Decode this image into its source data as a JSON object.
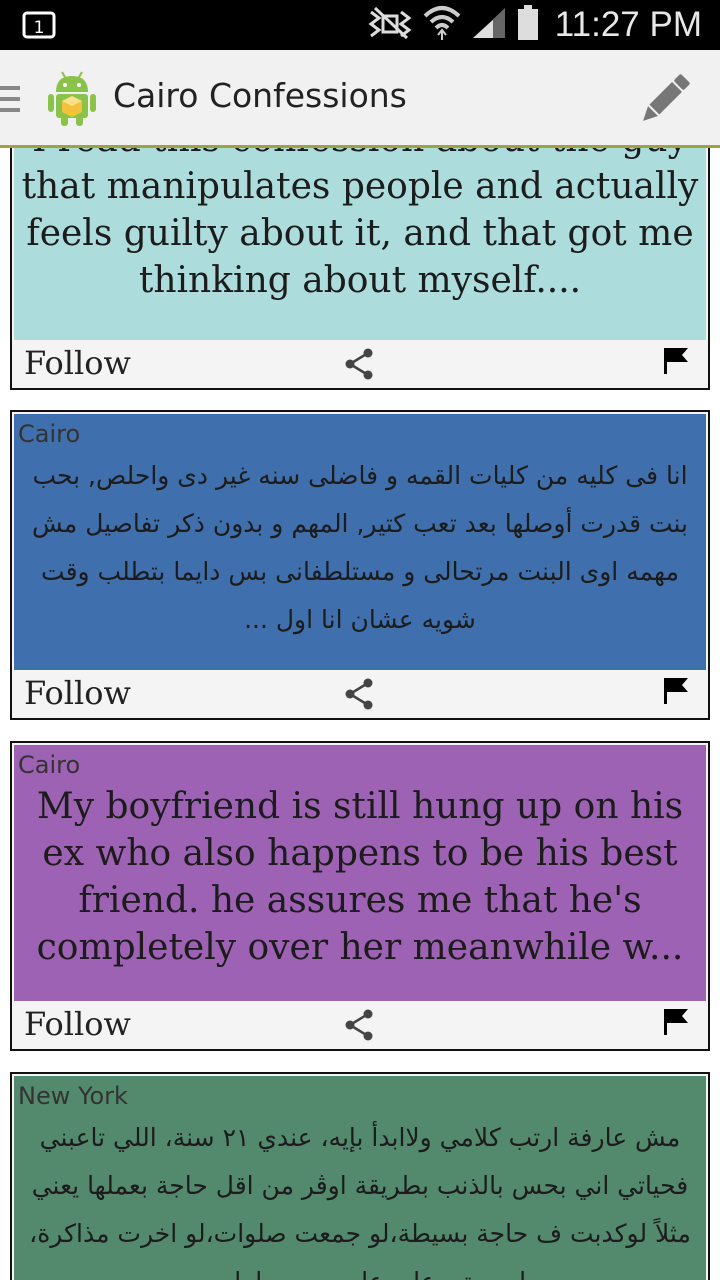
{
  "status_bar": {
    "time": "11:27 PM",
    "icons": [
      "notification-icon",
      "mute-icon",
      "wifi-icon",
      "signal-icon",
      "battery-icon"
    ]
  },
  "action_bar": {
    "title": "Cairo Confessions",
    "icons": [
      "menu-icon",
      "android-logo-icon",
      "compose-pencil-icon"
    ],
    "accent_color": "#9ea43a"
  },
  "cards": [
    {
      "location": "",
      "text": "I read this confession about the guy that manipulates people and actually feels guilty about it, and that got me thinking about myself....",
      "bg_color": "#acdcdc",
      "follow_label": "Follow"
    },
    {
      "location": "Cairo",
      "text": "انا فى كليه من كليات القمه و فاضلى سنه غير دى واحلص, بحب بنت قدرت أوصلها بعد تعب كتير, المهم و بدون ذكر تفاصيل مش مهمه اوى البنت مرتحالى و مستلطفانى بس دايما بتطلب وقت شويه عشان انا اول ...",
      "bg_color": "#3f6fad",
      "follow_label": "Follow"
    },
    {
      "location": "Cairo",
      "text": "My boyfriend is still hung up on his ex who also happens to be his best friend. he assures me that he's completely over her meanwhile w...",
      "bg_color": "#9e62b5",
      "follow_label": "Follow"
    },
    {
      "location": "New York",
      "text": "مش عارفة ارتب كلامي ولاابدأ بإيه، عندي ٢١ سنة، اللي تاعبني فحياتي اني بحس بالذنب بطريقة اوڤر من اقل حاجة بعملها يعني مثلاً لوكدبت ف حاجة بسيطة،لو جمعت صلوات،لو اخرت مذاكرة، لوصوتي علي عل صوت ماما من",
      "bg_color": "#538a6d",
      "follow_label": "Follow"
    }
  ]
}
